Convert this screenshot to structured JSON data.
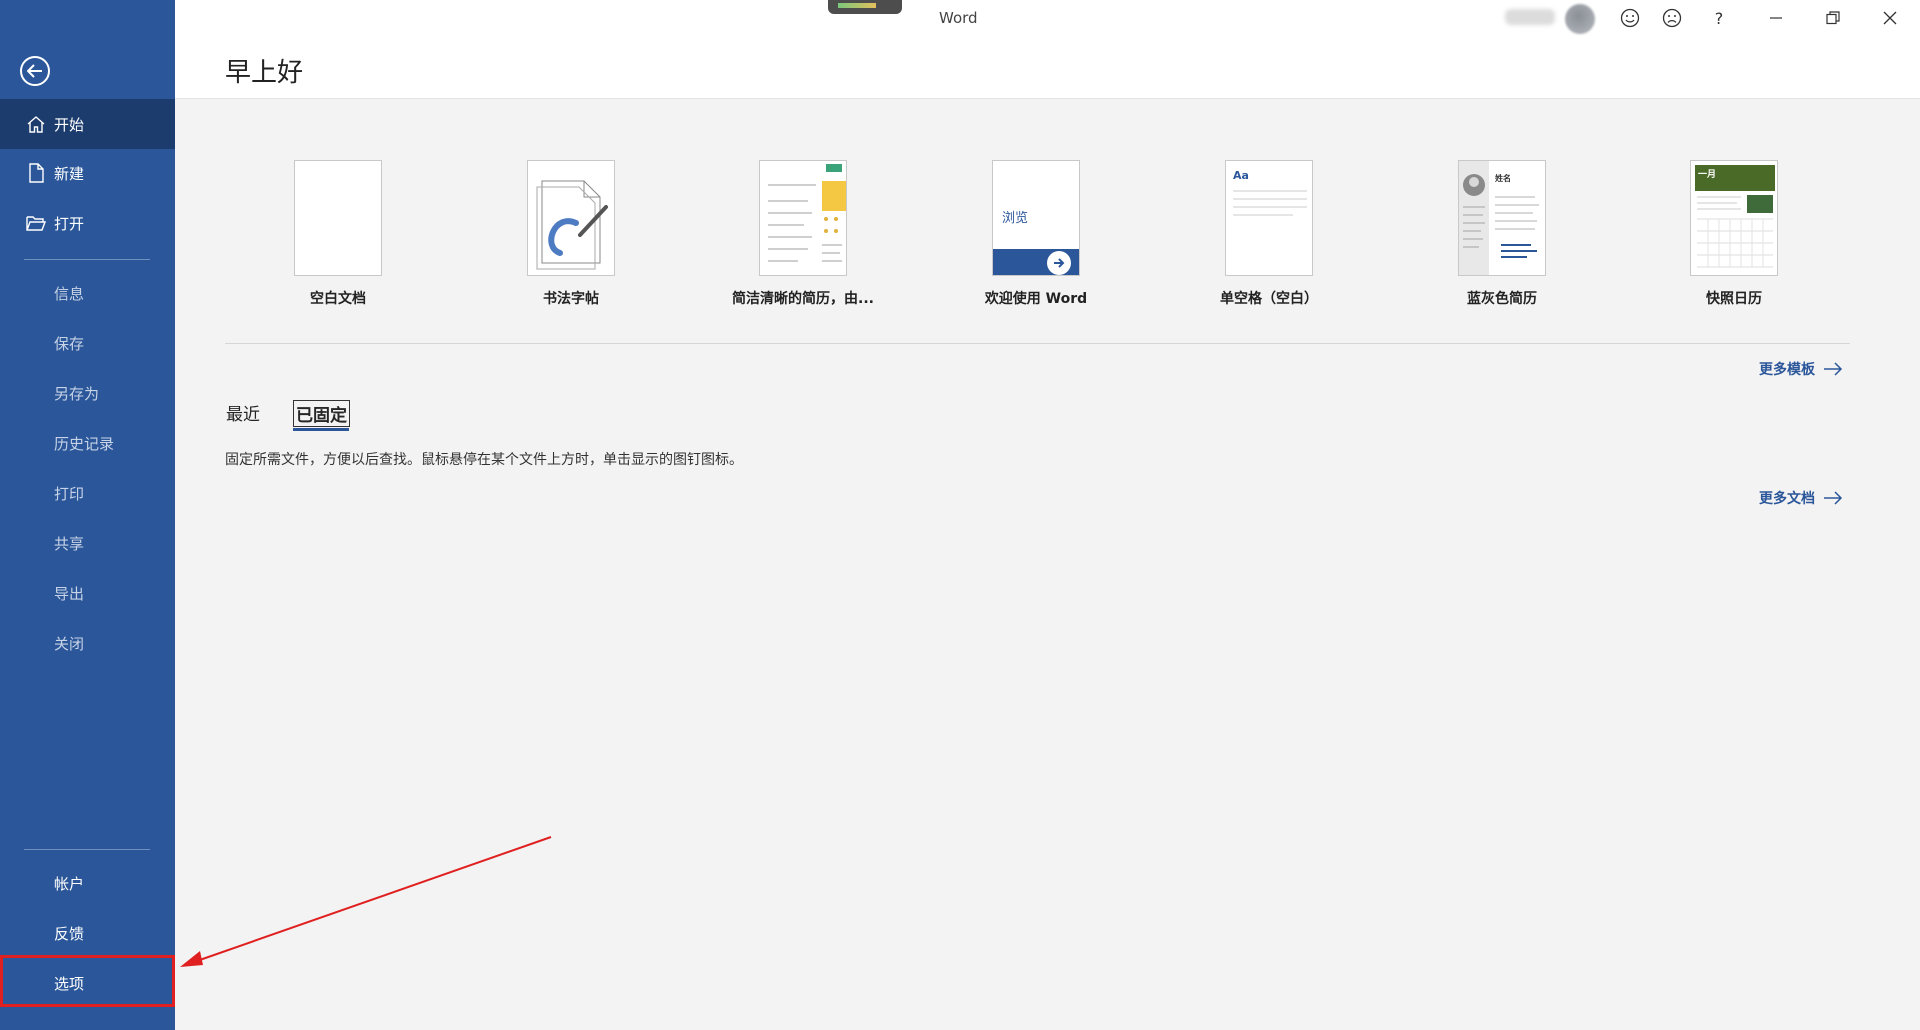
{
  "titlebar": {
    "app_title": "Word",
    "smile_icon": "smiley-icon",
    "frown_icon": "frown-icon",
    "help_label": "?"
  },
  "sidebar": {
    "items": [
      {
        "label": "开始"
      },
      {
        "label": "新建"
      },
      {
        "label": "打开"
      },
      {
        "label": "信息"
      },
      {
        "label": "保存"
      },
      {
        "label": "另存为"
      },
      {
        "label": "历史记录"
      },
      {
        "label": "打印"
      },
      {
        "label": "共享"
      },
      {
        "label": "导出"
      },
      {
        "label": "关闭"
      },
      {
        "label": "帐户"
      },
      {
        "label": "反馈"
      },
      {
        "label": "选项"
      }
    ]
  },
  "main": {
    "greeting": "早上好",
    "templates": [
      {
        "label": "空白文档"
      },
      {
        "label": "书法字帖"
      },
      {
        "label": "简洁清晰的简历，由..."
      },
      {
        "label": "欢迎使用 Word",
        "thumb_text": "浏览"
      },
      {
        "label": "单空格（空白）",
        "thumb_text": "Aa"
      },
      {
        "label": "蓝灰色简历",
        "thumb_text": "姓名"
      },
      {
        "label": "快照日历",
        "thumb_text": "一月"
      }
    ],
    "more_templates": "更多模板",
    "tabs": [
      {
        "label": "最近"
      },
      {
        "label": "已固定"
      }
    ],
    "pinned_message": "固定所需文件，方便以后查找。鼠标悬停在某个文件上方时，单击显示的图钉图标。",
    "more_documents": "更多文档"
  },
  "colors": {
    "sidebar": "#2b579a",
    "sidebar_active": "#1d3c6e",
    "annotation": "#e02020"
  }
}
